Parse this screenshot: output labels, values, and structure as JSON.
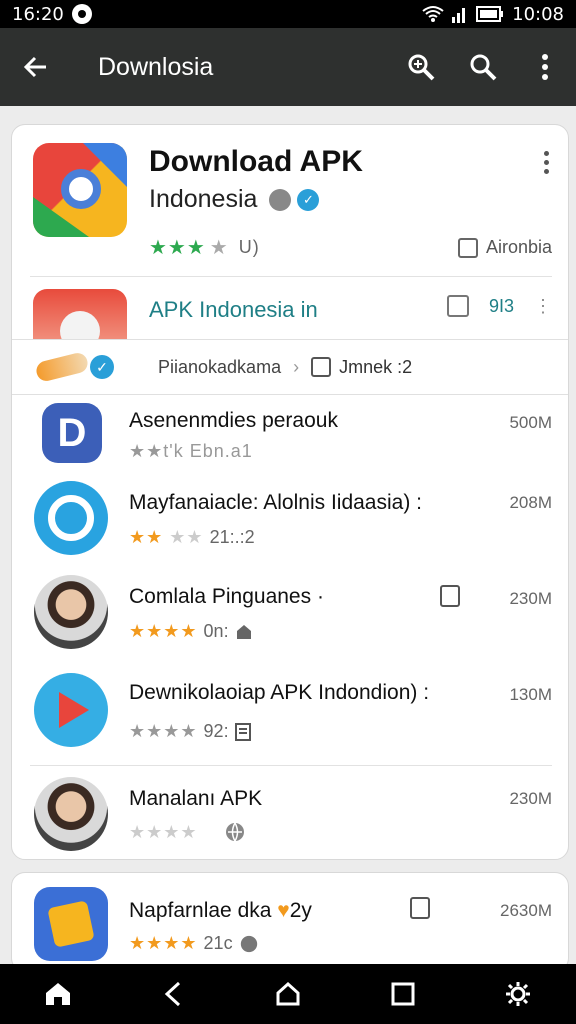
{
  "status": {
    "time_left": "16:20",
    "time_right": "10:08"
  },
  "appbar": {
    "title": "Downlosia"
  },
  "hero": {
    "name": "Download APK",
    "subtitle": "Indonesia",
    "stars": "★★★",
    "stars_empty": "★",
    "rating_count": "U)",
    "tag": "Aironbia"
  },
  "featured": {
    "title": "APK Indonesia in",
    "count": "9I3"
  },
  "crumbs": {
    "first": "Piianokadkama",
    "second": "Jmnek :2"
  },
  "apps": [
    {
      "name": "Asenenmdies peraouk",
      "meta": "★★t'k Ebn.a1",
      "size": "500M"
    },
    {
      "name": "Mayfanaiacle: Alolnis Iidaasia) :",
      "stars": "★★",
      "stars_grey": "★★",
      "meta": "21:.:2",
      "size": "208M"
    },
    {
      "name": "Comlala Pinguanes ·",
      "stars": "★★★★",
      "meta": "0n:",
      "size": "230M"
    },
    {
      "name": "Dewnikolaoiap APK Indondion) :",
      "stars": "★★★★",
      "meta": "92:",
      "size": "130M"
    },
    {
      "name": "Manalanı APK",
      "stars": "★★★★",
      "meta": "",
      "size": "230M"
    }
  ],
  "app_card2": {
    "name": "Napfarnlae dka",
    "stars": "★★★★",
    "meta": "21c",
    "size": "2630M"
  },
  "nav": [
    "home-icon",
    "back-icon",
    "recents-icon",
    "square-icon",
    "settings-icon"
  ]
}
